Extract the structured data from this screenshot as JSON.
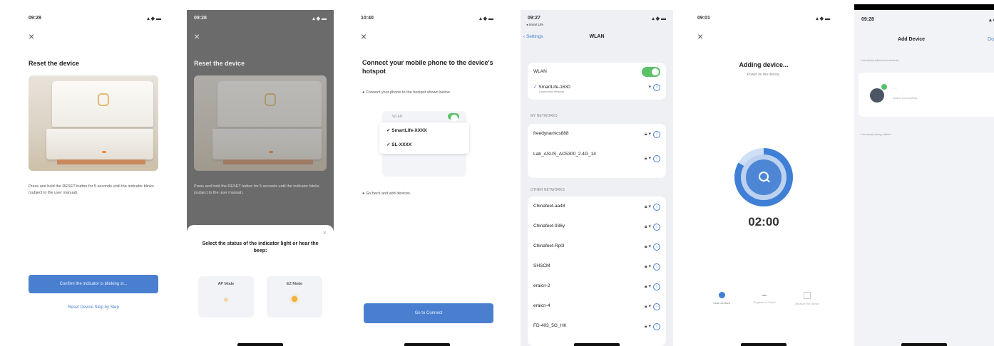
{
  "screen1": {
    "status_time": "09:28",
    "status_icons": "▴ ◆ ▬",
    "close": "×",
    "title": "Reset the device",
    "instruction": "Press and hold the RESET button for 5 seconds until the indicator blinks (subject to the user manual).",
    "confirm_button": "Confirm the indicator is blinking st...",
    "reset_link": "Reset Device Step by Step"
  },
  "screen2": {
    "status_time": "09:28",
    "status_icons": "▴ ◆ ▬",
    "close": "×",
    "title": "Reset the device",
    "instruction": "Press and hold the RESET button for 5 seconds until the indicator blinks (subject to the user manual).",
    "sheet_close": "×",
    "sheet_title": "Select the status of the indicator light or hear the beep:",
    "option_ap": "AP Mode",
    "option_ez": "EZ Mode"
  },
  "screen3": {
    "status_time": "10:40",
    "status_icons": "▴ ◆ ▬",
    "close": "×",
    "title": "Connect your mobile phone to the device's hotspot",
    "step1": "● Connect your phone to the hotspot shown below.",
    "wlan_label": "WLAN",
    "net1": "SmartLife-XXXX",
    "net2": "SL-XXXX",
    "step2": "● Go back and add devices.",
    "connect_button": "Go to Connect"
  },
  "screen4": {
    "status_time": "09:27",
    "status_sub": "◂ Smart Life",
    "status_icons": "▴ ◆ ▬",
    "back": "‹ Settings",
    "title": "WLAN",
    "wlan_label": "WLAN",
    "connected_name": "SmartLife-1630",
    "connected_sub": "Unsecured Network",
    "section_my": "MY NETWORKS",
    "my_networks": [
      "freedynamics888",
      "Lab_ASUS_AC5300_2.4G_14"
    ],
    "section_other": "OTHER NETWORKS",
    "other_networks": [
      "Chinafeet-aa48",
      "Chinafeet-936y",
      "Chinafeet-Rp0l",
      "SHSCM",
      "eraicn-2",
      "eraicn-4",
      "FD-403_5G_HK"
    ]
  },
  "screen5": {
    "status_time": "09:01",
    "status_icons": "▴ ◆ ▬",
    "close": "×",
    "title": "Adding device...",
    "subtitle": "Power on the device.",
    "search_icon": "search-icon",
    "countdown": "02:00",
    "steps": [
      "Scan devices",
      "Register to Cloud",
      "Initialize the device"
    ]
  },
  "screen6": {
    "status_time": "09:28",
    "status_icons": "▴ ◆",
    "title": "Add Device",
    "done": "Do",
    "note": "1 device(s) added successfully",
    "device_name": "···",
    "device_sub": "Added successfully",
    "footer": "1 device(s) being added"
  },
  "colors": {
    "accent": "#4a7fd0",
    "toggle": "#5cc26a",
    "led": "#e58a3a"
  }
}
